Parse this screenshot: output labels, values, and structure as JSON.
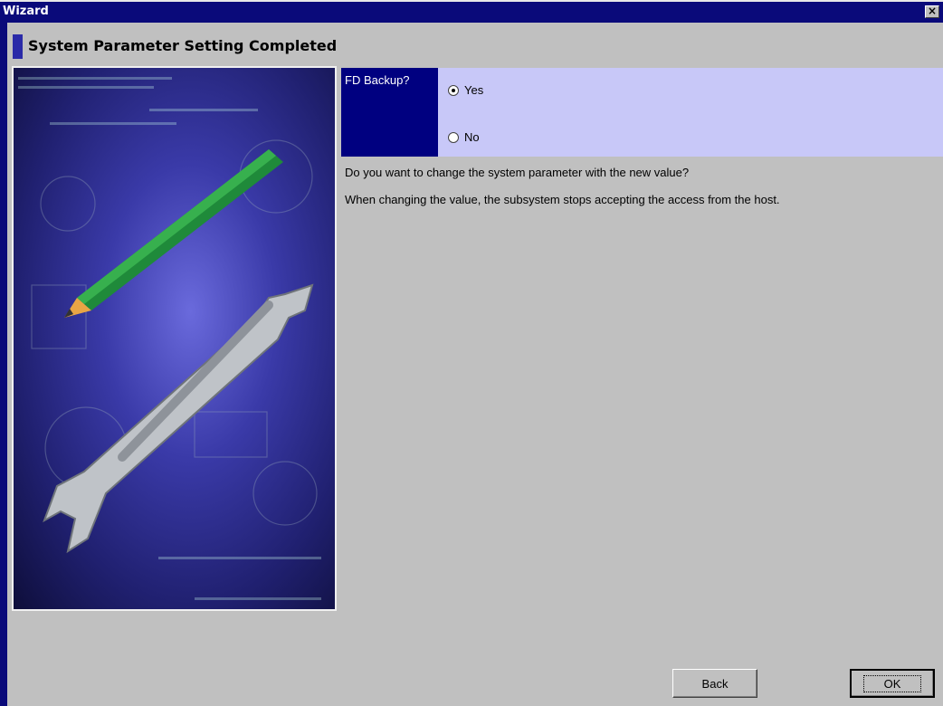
{
  "window": {
    "title": "Wizard",
    "close_glyph": "×"
  },
  "header": {
    "title": "System Parameter Setting Completed"
  },
  "illustration": {
    "icons": [
      "pencil-icon",
      "wrench-icon"
    ]
  },
  "form": {
    "label": "FD Backup?",
    "options": [
      {
        "label": "Yes",
        "selected": true
      },
      {
        "label": "No",
        "selected": false
      }
    ]
  },
  "messages": {
    "question": "Do you want to change the system parameter with the new value?",
    "warning": "When changing the value, the subsystem stops accepting the access from the host."
  },
  "buttons": {
    "back": "Back",
    "ok": "OK"
  },
  "colors": {
    "title_bar": "#0a0a7a",
    "label_bg": "#000080",
    "options_bg": "#c8c8f8",
    "window_bg": "#c0c0c0"
  }
}
